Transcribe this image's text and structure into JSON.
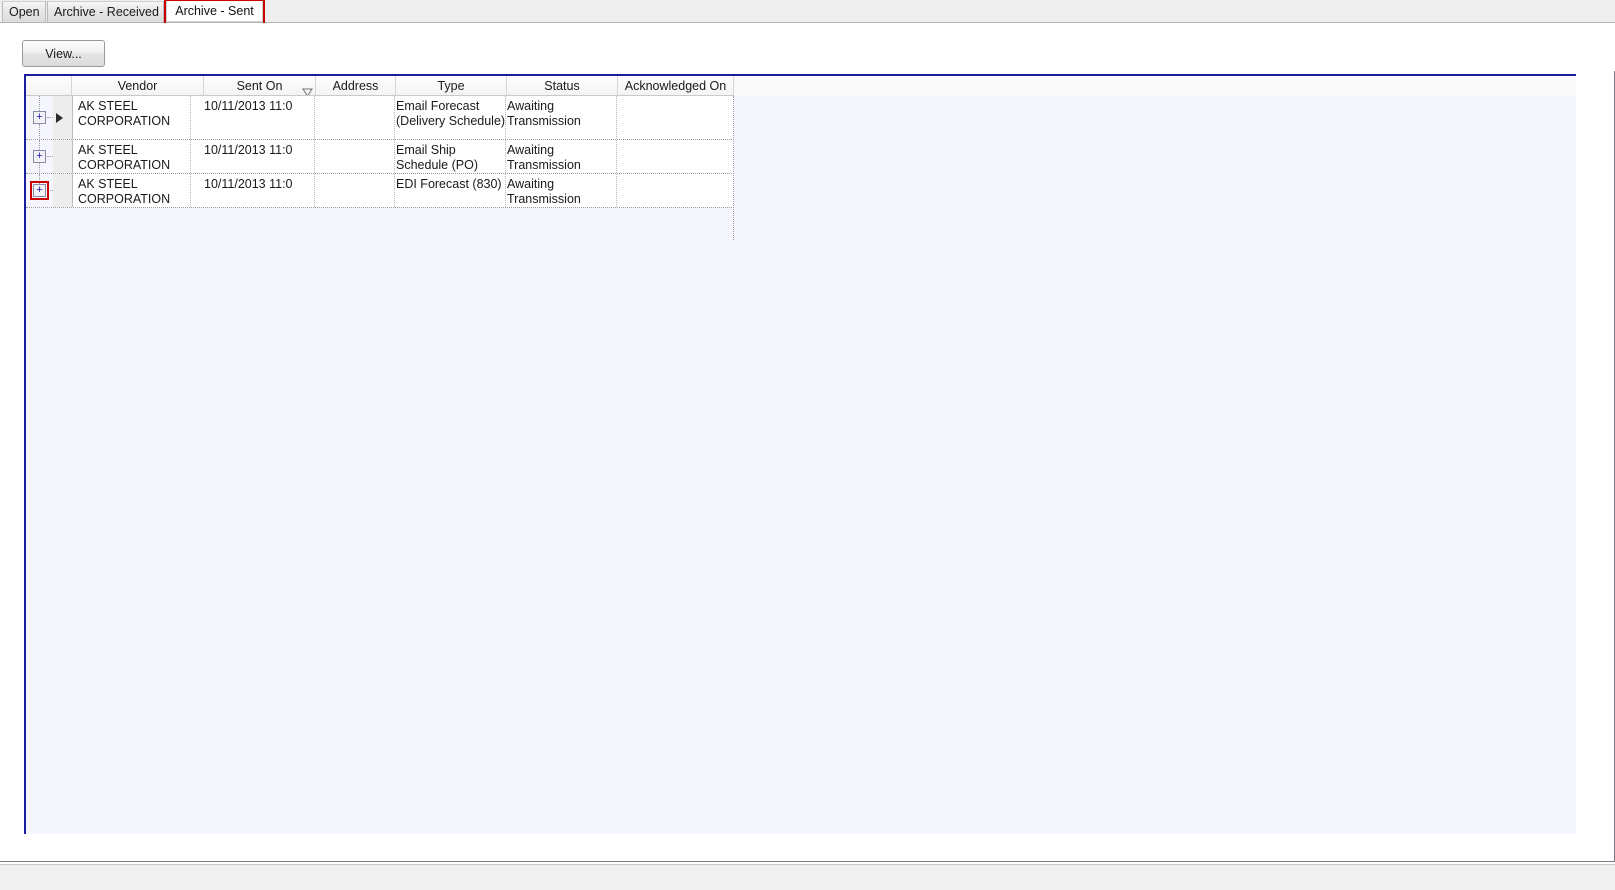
{
  "window": {
    "title": "Archive - Sent"
  },
  "tabs": [
    {
      "id": "open",
      "label": "Open",
      "active": false
    },
    {
      "id": "archive-received",
      "label": "Archive - Received",
      "active": false
    },
    {
      "id": "archive-sent",
      "label": "Archive - Sent",
      "active": true
    }
  ],
  "toolbar": {
    "view_label": "View..."
  },
  "grid": {
    "columns": [
      {
        "key": "indent",
        "label": ""
      },
      {
        "key": "vendor",
        "label": "Vendor"
      },
      {
        "key": "sent_on",
        "label": "Sent On",
        "sort": "descending",
        "sort_icon": "sort-descending-icon"
      },
      {
        "key": "address",
        "label": "Address"
      },
      {
        "key": "type",
        "label": "Type"
      },
      {
        "key": "status",
        "label": "Status"
      },
      {
        "key": "acknowledged_on",
        "label": "Acknowledged On"
      }
    ],
    "rows": [
      {
        "expander": "plus-icon",
        "expander_highlighted": false,
        "current_row": true,
        "vendor": "AK STEEL CORPORATION",
        "sent_on": "10/11/2013 11:0",
        "address": "",
        "type": "Email Forecast (Delivery Schedule)",
        "status": "Awaiting Transmission",
        "acknowledged_on": ""
      },
      {
        "expander": "plus-icon",
        "expander_highlighted": false,
        "current_row": false,
        "vendor": "AK STEEL CORPORATION",
        "sent_on": "10/11/2013 11:0",
        "address": "",
        "type": "Email Ship Schedule (PO)",
        "status": "Awaiting Transmission",
        "acknowledged_on": ""
      },
      {
        "expander": "plus-icon",
        "expander_highlighted": true,
        "current_row": false,
        "vendor": "AK STEEL CORPORATION",
        "sent_on": "10/11/2013 11:0",
        "address": "",
        "type": "EDI Forecast (830)",
        "status": "Awaiting Transmission",
        "acknowledged_on": ""
      }
    ]
  },
  "colors": {
    "panel_border": "#1c1c9e",
    "panel_bg": "#f5f6fd",
    "annotation": "#cc0000",
    "expander_glyph": "#1c1cae"
  }
}
